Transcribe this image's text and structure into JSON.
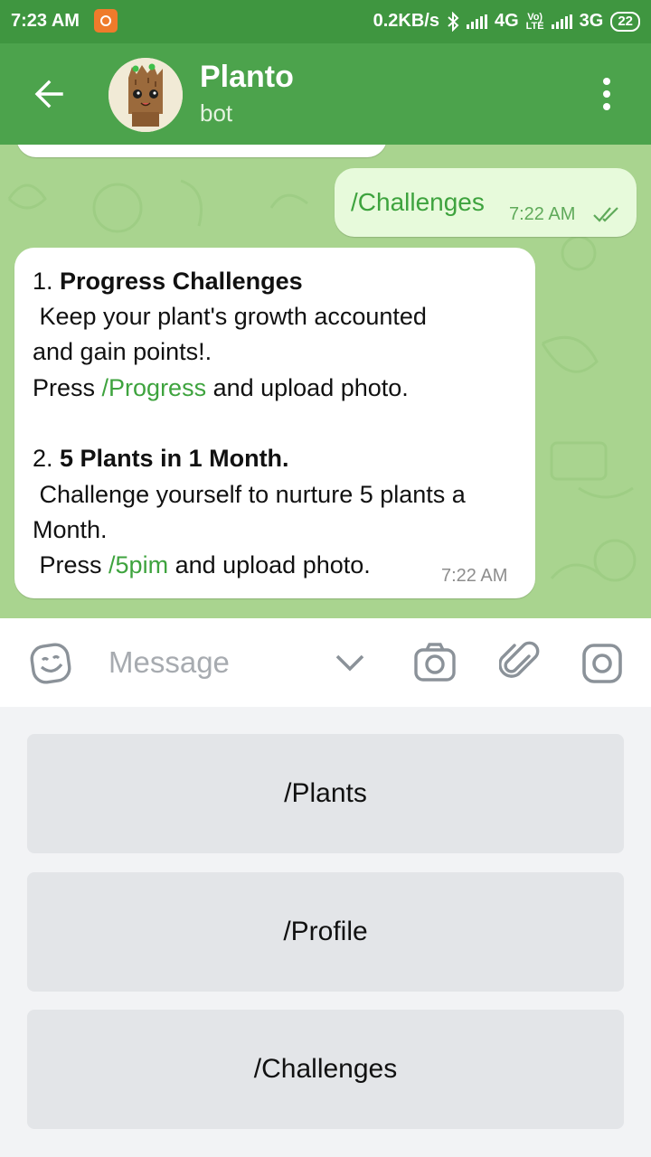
{
  "status_bar": {
    "time": "7:23 AM",
    "network_speed": "0.2KB/s",
    "network_4g": "4G",
    "volte_top": "Vo)",
    "volte_bottom": "LTE",
    "network_3g": "3G",
    "battery": "22"
  },
  "header": {
    "title": "Planto",
    "subtitle": "bot"
  },
  "messages": {
    "outgoing": {
      "text": "/Challenges",
      "time": "7:22 AM"
    },
    "incoming": {
      "line1_num": "1. ",
      "line1_bold": "Progress Challenges",
      "line2": " Keep your plant's growth accounted",
      "line3": "and gain points!.",
      "line4_pre": "Press ",
      "line4_link": "/Progress",
      "line4_post": " and upload photo.",
      "line5_num": "2. ",
      "line5_bold": "5 Plants in 1 Month.",
      "line6": " Challenge yourself to nurture 5 plants a",
      "line7": "Month.",
      "line8_pre": " Press ",
      "line8_link": "/5pim",
      "line8_post": " and upload photo.",
      "time": "7:22 AM"
    }
  },
  "composer": {
    "placeholder": "Message"
  },
  "keyboard": {
    "buttons": [
      "/Plants",
      "/Profile",
      "/Challenges"
    ]
  },
  "colors": {
    "header": "#4ca34c",
    "status_bar": "#3f9640",
    "chat_background": "#a9d48f",
    "outgoing_bubble": "#e7fadb",
    "link": "#3ea33e"
  },
  "icons": {
    "back": "arrow-left-icon",
    "menu": "more-vertical-icon",
    "emoji": "emoji-icon",
    "chevron": "chevron-down-icon",
    "camera": "camera-icon",
    "attach": "paperclip-icon",
    "instagram": "instagram-icon",
    "checks": "double-check-icon"
  }
}
